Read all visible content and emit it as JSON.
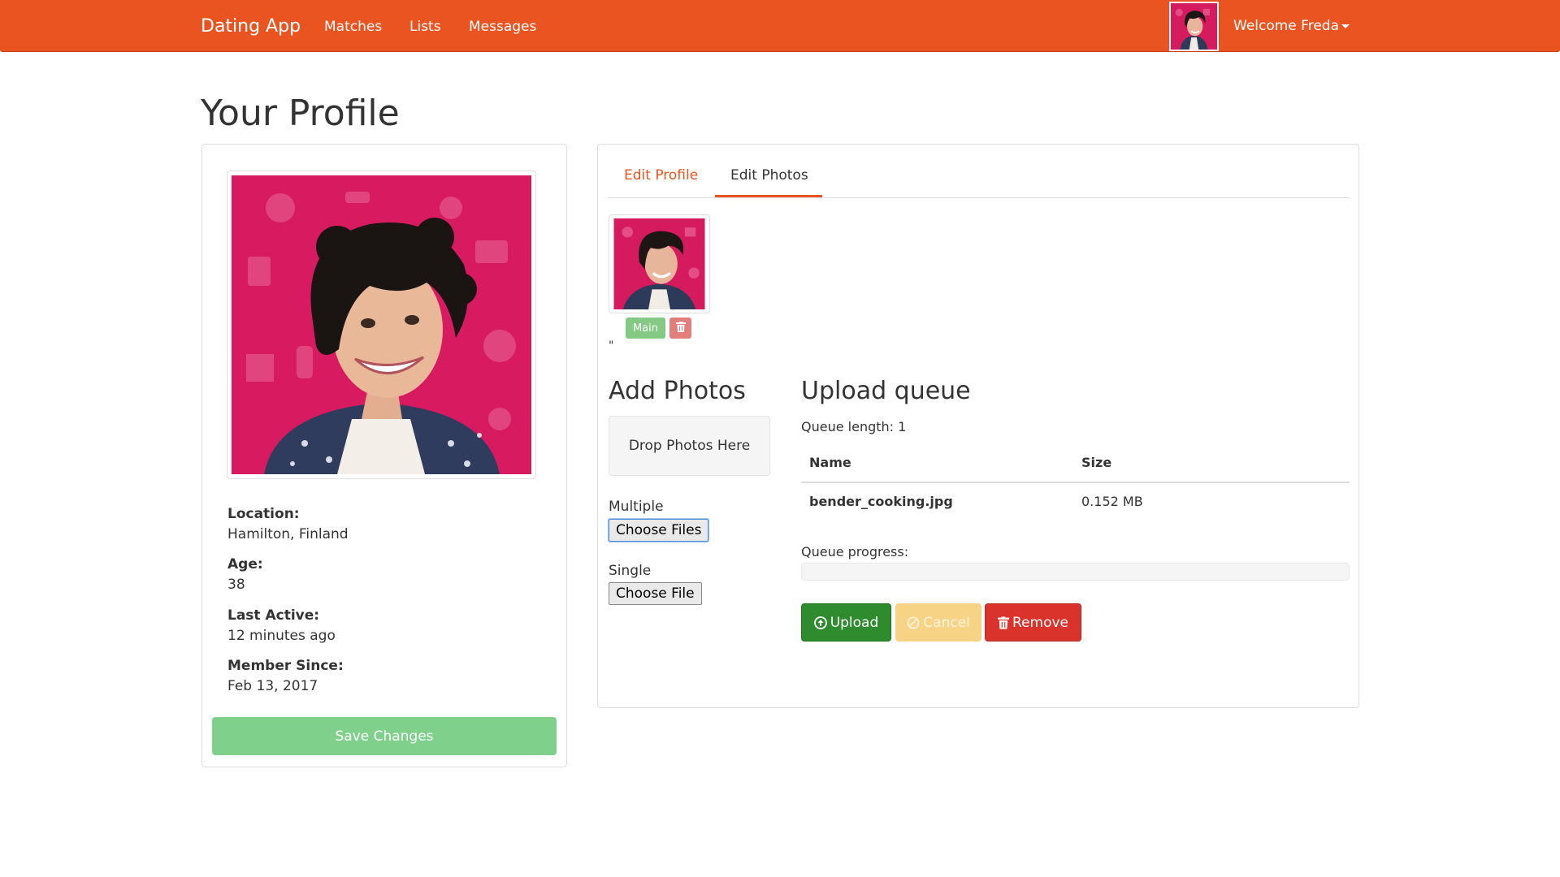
{
  "navbar": {
    "brand": "Dating App",
    "links": [
      "Matches",
      "Lists",
      "Messages"
    ],
    "welcome": "Welcome Freda",
    "accent_color": "#e95420"
  },
  "page": {
    "title": "Your Profile"
  },
  "profile": {
    "fields": [
      {
        "label": "Location:",
        "value": "Hamilton, Finland"
      },
      {
        "label": "Age:",
        "value": "38"
      },
      {
        "label": "Last Active:",
        "value": "12 minutes ago"
      },
      {
        "label": "Member Since:",
        "value": "Feb 13, 2017"
      }
    ],
    "save_label": "Save Changes"
  },
  "tabs": {
    "edit_profile": "Edit Profile",
    "edit_photos": "Edit Photos",
    "active": "Edit Photos"
  },
  "photos": {
    "main_label": "Main",
    "trash_icon": "trash-icon",
    "stray_text": "\""
  },
  "add_photos": {
    "heading": "Add Photos",
    "drop_zone": "Drop Photos Here",
    "multiple_label": "Multiple",
    "multiple_button": "Choose Files",
    "single_label": "Single",
    "single_button": "Choose File"
  },
  "upload_queue": {
    "heading": "Upload queue",
    "queue_length": "Queue length: 1",
    "columns": [
      "Name",
      "Size"
    ],
    "rows": [
      {
        "name": "bender_cooking.jpg",
        "size": "0.152 MB"
      }
    ],
    "progress_label": "Queue progress:",
    "progress_value": 0,
    "buttons": {
      "upload": "Upload",
      "cancel": "Cancel",
      "remove": "Remove"
    }
  }
}
